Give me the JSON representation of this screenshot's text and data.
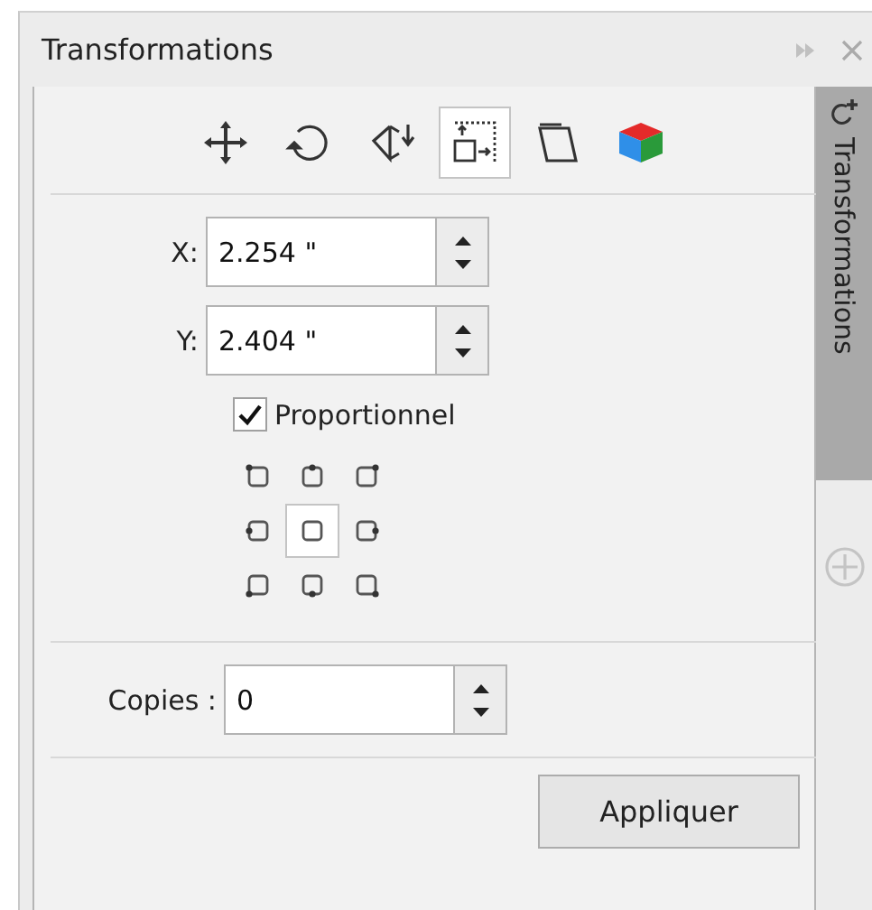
{
  "window": {
    "title": "Transformations"
  },
  "tools": [
    {
      "kind": "position",
      "selected": false
    },
    {
      "kind": "rotate",
      "selected": false
    },
    {
      "kind": "mirror",
      "selected": false
    },
    {
      "kind": "size",
      "selected": true
    },
    {
      "kind": "skew",
      "selected": false
    },
    {
      "kind": "cube",
      "selected": false
    }
  ],
  "fields": [
    {
      "label": "X:",
      "value": "2.254 \""
    },
    {
      "label": "Y:",
      "value": "2.404 \""
    }
  ],
  "proportional": {
    "label": "Proportionnel",
    "checked": true
  },
  "anchors": [
    {
      "selected": false
    },
    {
      "selected": false
    },
    {
      "selected": false
    },
    {
      "selected": false
    },
    {
      "selected": true
    },
    {
      "selected": false
    },
    {
      "selected": false
    },
    {
      "selected": false
    },
    {
      "selected": false
    }
  ],
  "copies": {
    "label": "Copies :",
    "value": "0"
  },
  "apply_button": "Appliquer",
  "side_tab": {
    "label": "Transformations",
    "selected": true
  }
}
